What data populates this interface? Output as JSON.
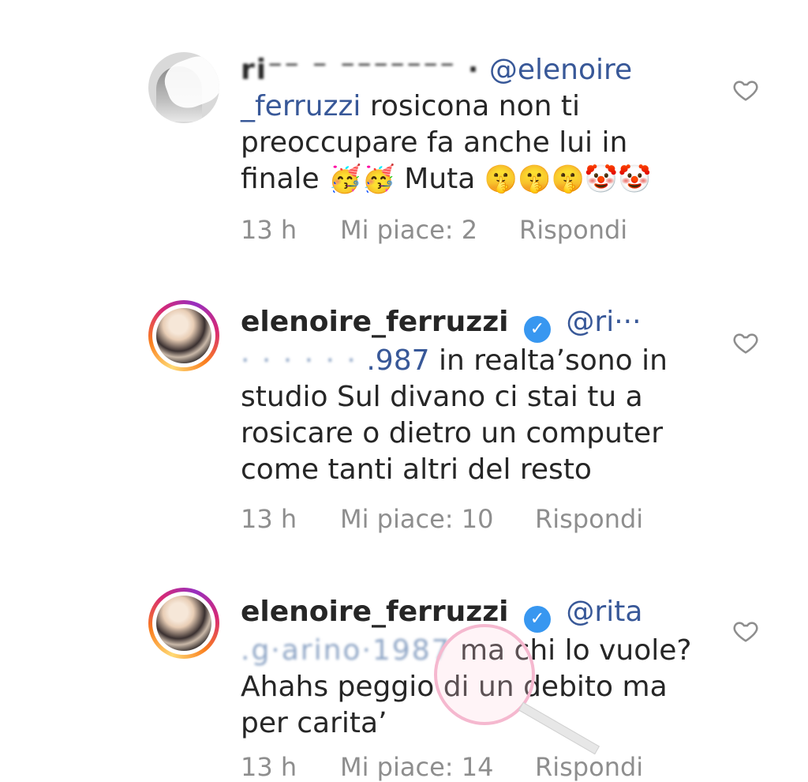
{
  "comments": [
    {
      "user_obscured": "ri⁻⁻  ⁻  ⁻⁻⁻⁻⁻⁻⁻ ·",
      "mention1": "@elenoire",
      "mention2": "_ferruzzi",
      "line1": "rosicona non ti",
      "line2": "preoccupare fa anche lui in",
      "line3": "finale",
      "emoji1": "🥳🥳",
      "line3b": "Muta",
      "emoji2": "🤫🤫🤫🤡🤡",
      "time": "13 h",
      "likes": "Mi piace: 2",
      "reply": "Rispondi"
    },
    {
      "user": "elenoire_ferruzzi",
      "mention_start": "@ri···",
      "mention_obscured": "·  ·  ·  ·  ·  ·",
      "mention_end": ".987",
      "line1": "in realta’sono in",
      "line2": "studio Sul divano ci stai tu a",
      "line3": "rosicare o dietro un computer",
      "line4": "come tanti altri del resto",
      "time": "13 h",
      "likes": "Mi piace: 10",
      "reply": "Rispondi"
    },
    {
      "user": "elenoire_ferruzzi",
      "mention_start": "@rita",
      "mention_obscured": ".g·arino·1987",
      "line1": "ma chi lo vuole?",
      "line2": "Ahahs peggio di un debito ma",
      "line3": "per carita’",
      "time": "13 h",
      "likes": "Mi piace: 14",
      "reply": "Rispondi"
    }
  ],
  "verified_glyph": "✓",
  "icons": {
    "like": "heart-outline-icon"
  }
}
